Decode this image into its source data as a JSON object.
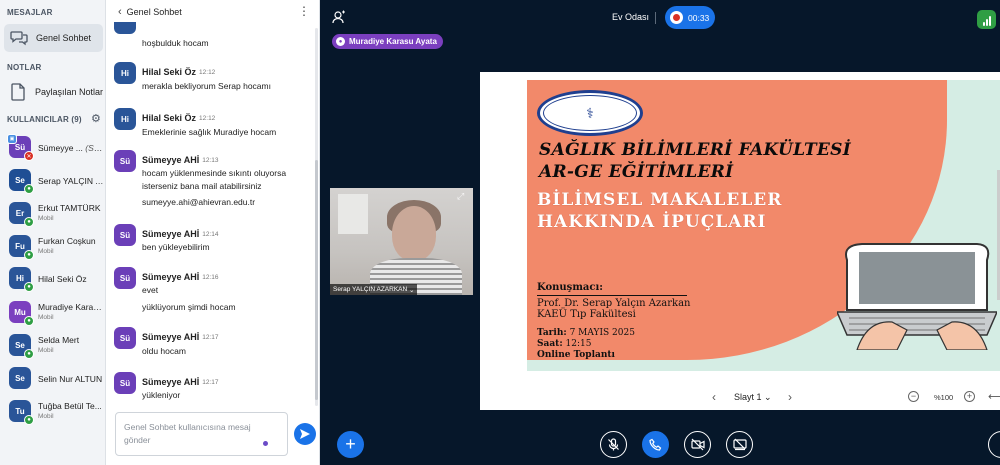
{
  "sidebar": {
    "messages_title": "MESAJLAR",
    "public_chat_label": "Genel Sohbet",
    "notes_title": "NOTLAR",
    "shared_notes_label": "Paylaşılan Notlar",
    "users_title": "KULLANICILAR (9)",
    "users": [
      {
        "initials": "Sü",
        "name": "Sümeyye ...",
        "suffix": "(Sen)",
        "role": "",
        "color": "#6b3fb8"
      },
      {
        "initials": "Se",
        "name": "Serap YALÇIN A...",
        "suffix": "",
        "role": "",
        "color": "#1f4e94"
      },
      {
        "initials": "Er",
        "name": "Erkut TAMTÜRK",
        "suffix": "",
        "role": "Mobil",
        "color": "#2a5598"
      },
      {
        "initials": "Fu",
        "name": "Furkan Coşkun",
        "suffix": "",
        "role": "Mobil",
        "color": "#2a5598"
      },
      {
        "initials": "Hi",
        "name": "Hilal Seki Öz",
        "suffix": "",
        "role": "",
        "color": "#2a5598"
      },
      {
        "initials": "Mu",
        "name": "Muradiye Karas...",
        "suffix": "",
        "role": "Mobil",
        "color": "#7b3fbf"
      },
      {
        "initials": "Se",
        "name": "Selda Mert",
        "suffix": "",
        "role": "Mobil",
        "color": "#2a5598"
      },
      {
        "initials": "Se",
        "name": "Selin Nur ALTUN",
        "suffix": "",
        "role": "",
        "color": "#2a5598"
      },
      {
        "initials": "Tu",
        "name": "Tuğba Betül Te...",
        "suffix": "",
        "role": "Mobil",
        "color": "#2a5598"
      }
    ]
  },
  "chat": {
    "title": "Genel Sohbet",
    "first_line": "hoşbulduk hocam",
    "messages": [
      {
        "initials": "Hi",
        "author": "Hilal Seki Öz",
        "time": "12:12",
        "lines": [
          "merakla bekliyorum Serap hocamı"
        ],
        "color": "#2a5598"
      },
      {
        "initials": "Hi",
        "author": "Hilal Seki Öz",
        "time": "12:12",
        "lines": [
          "Emeklerinie sağlık Muradiye hocam"
        ],
        "color": "#2a5598"
      },
      {
        "initials": "Sü",
        "author": "Sümeyye AHİ",
        "time": "12:13",
        "lines": [
          "hocam yüklenmesinde sıkıntı oluyorsa",
          "isterseniz bana mail atabilirsiniz",
          "sumeyye.ahi@ahievran.edu.tr"
        ],
        "color": "#6b3fb8"
      },
      {
        "initials": "Sü",
        "author": "Sümeyye AHİ",
        "time": "12:14",
        "lines": [
          "ben yükleyebilirim"
        ],
        "color": "#6b3fb8"
      },
      {
        "initials": "Sü",
        "author": "Sümeyye AHİ",
        "time": "12:16",
        "lines": [
          "evet",
          "yüklüyorum şimdi hocam"
        ],
        "color": "#6b3fb8"
      },
      {
        "initials": "Sü",
        "author": "Sümeyye AHİ",
        "time": "12:17",
        "lines": [
          "oldu hocam"
        ],
        "color": "#6b3fb8"
      },
      {
        "initials": "Sü",
        "author": "Sümeyye AHİ",
        "time": "12:17",
        "lines": [
          "yükleniyor"
        ],
        "color": "#6b3fb8"
      }
    ],
    "input_placeholder": "Genel Sohbet kullanıcısına mesaj gönder"
  },
  "main": {
    "room_name": "Ev Odası",
    "rec_time": "00:33",
    "talker": "Muradiye Karasu Ayata",
    "webcam_name": "Serap YALÇIN AZARKAN",
    "slide": {
      "line1": "SAĞLIK BİLİMLERİ FAKÜLTESİ",
      "line2": "AR-GE EĞİTİMLERİ",
      "line3": "BİLİMSEL MAKALELER",
      "line4": "HAKKINDA İPUÇLARI",
      "speaker_label": "Konuşmacı:",
      "speaker_name": "Prof. Dr. Serap Yalçın Azarkan",
      "speaker_org": "KAEÜ Tıp Fakültesi",
      "date_label": "Tarih:",
      "date_value": "7 MAYIS 2025",
      "time_label": "Saat:",
      "time_value": "12:15",
      "mode": "Online Toplantı"
    },
    "slide_selector": "Slayt 1",
    "zoom": "%100"
  },
  "colors": {
    "accent": "#1a73e8",
    "talker": "#7b3fbf",
    "background": "#06172a",
    "network_ok": "#2f9e44",
    "record": "#d93025"
  }
}
